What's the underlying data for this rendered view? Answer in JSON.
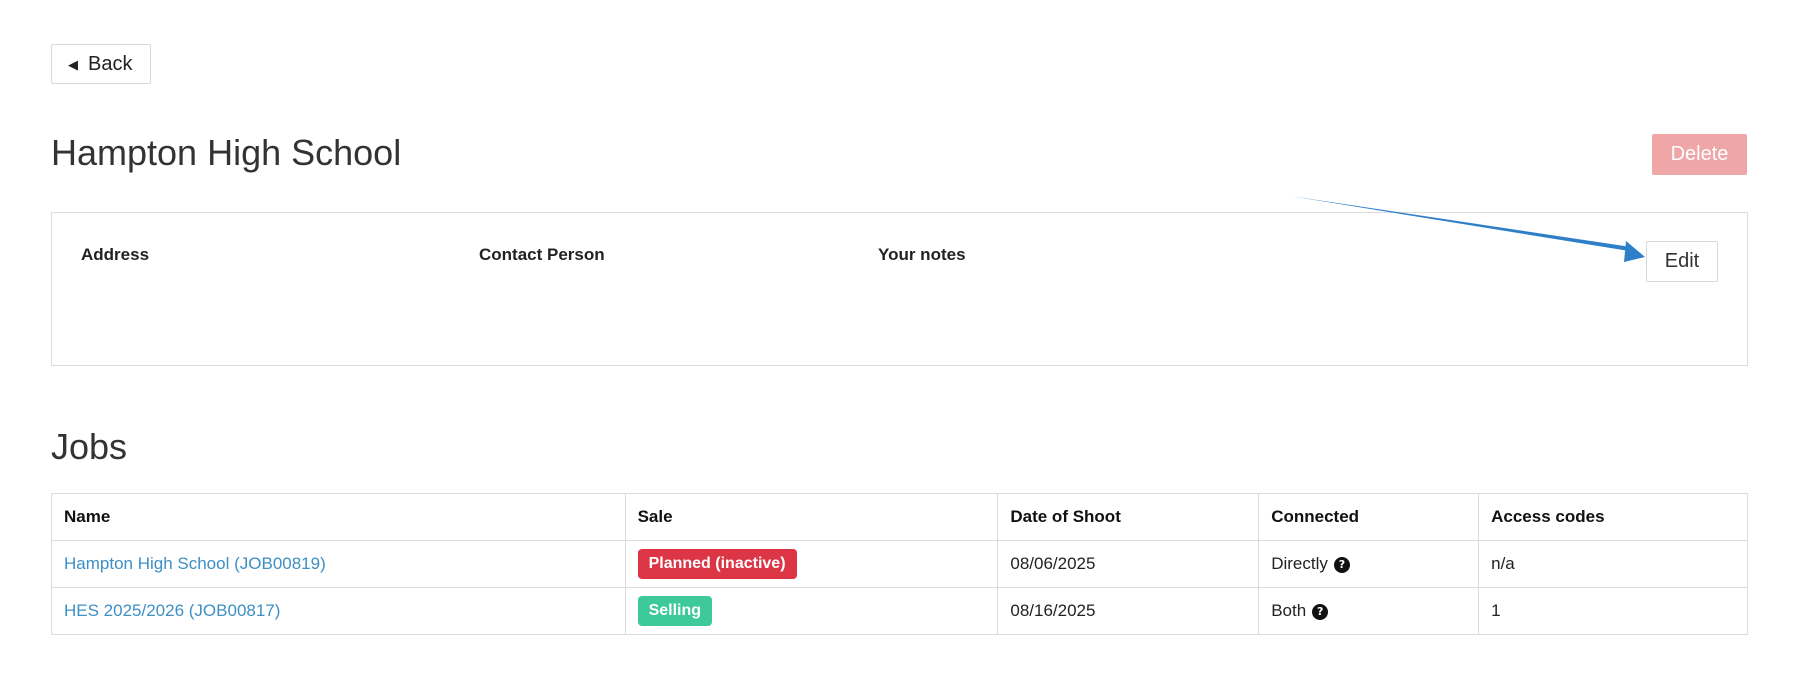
{
  "nav": {
    "back_label": "Back"
  },
  "header": {
    "title": "Hampton High School",
    "delete_label": "Delete"
  },
  "info": {
    "address_label": "Address",
    "contact_label": "Contact Person",
    "notes_label": "Your notes",
    "edit_label": "Edit"
  },
  "jobs": {
    "title": "Jobs",
    "columns": [
      "Name",
      "Sale",
      "Date of Shoot",
      "Connected",
      "Access codes"
    ],
    "rows": [
      {
        "name": "Hampton High School (JOB00819)",
        "sale": "Planned (inactive)",
        "sale_color": "#dc3545",
        "date": "08/06/2025",
        "connected": "Directly",
        "access": "n/a"
      },
      {
        "name": "HES 2025/2026 (JOB00817)",
        "sale": "Selling",
        "sale_color": "#3ec99a",
        "date": "08/16/2025",
        "connected": "Both",
        "access": "1"
      }
    ]
  },
  "colors": {
    "link": "#3d8fc4",
    "delete": "#eea6a6",
    "annotation_arrow": "#2f7fc8"
  },
  "icons": {
    "back": "caret-left-icon",
    "help": "question-circle-icon"
  }
}
